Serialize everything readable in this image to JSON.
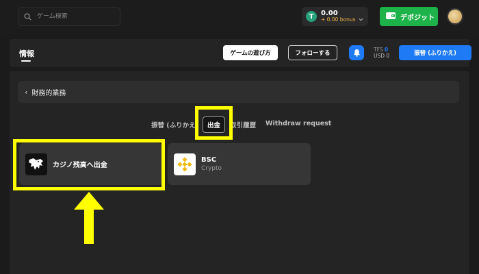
{
  "header": {
    "search_placeholder": "ゲーム検索",
    "balance": "0.00",
    "bonus": "+ 0.00 bonus",
    "deposit_label": "デポジット"
  },
  "subheader": {
    "info_tab": "情報",
    "guide_label": "ゲームの遊び方",
    "follow_label": "フォローする",
    "tfs_label": "TFS",
    "tfs_value": "0",
    "usd_text": "USD 0",
    "transfer_label": "振替 (ふりかえ)"
  },
  "main": {
    "breadcrumb": "財務的業務",
    "tabs": [
      "振替 (ふりかえ",
      "出金",
      "取引履歴",
      "Withdraw request"
    ],
    "methods": [
      {
        "title": "カジノ残高へ出金",
        "subtitle": ""
      },
      {
        "title": "BSC",
        "subtitle": "Crypto"
      }
    ]
  },
  "colors": {
    "accent_blue": "#1e7bf5",
    "deposit_green": "#1db34a",
    "annotation_yellow": "#ffff00"
  }
}
